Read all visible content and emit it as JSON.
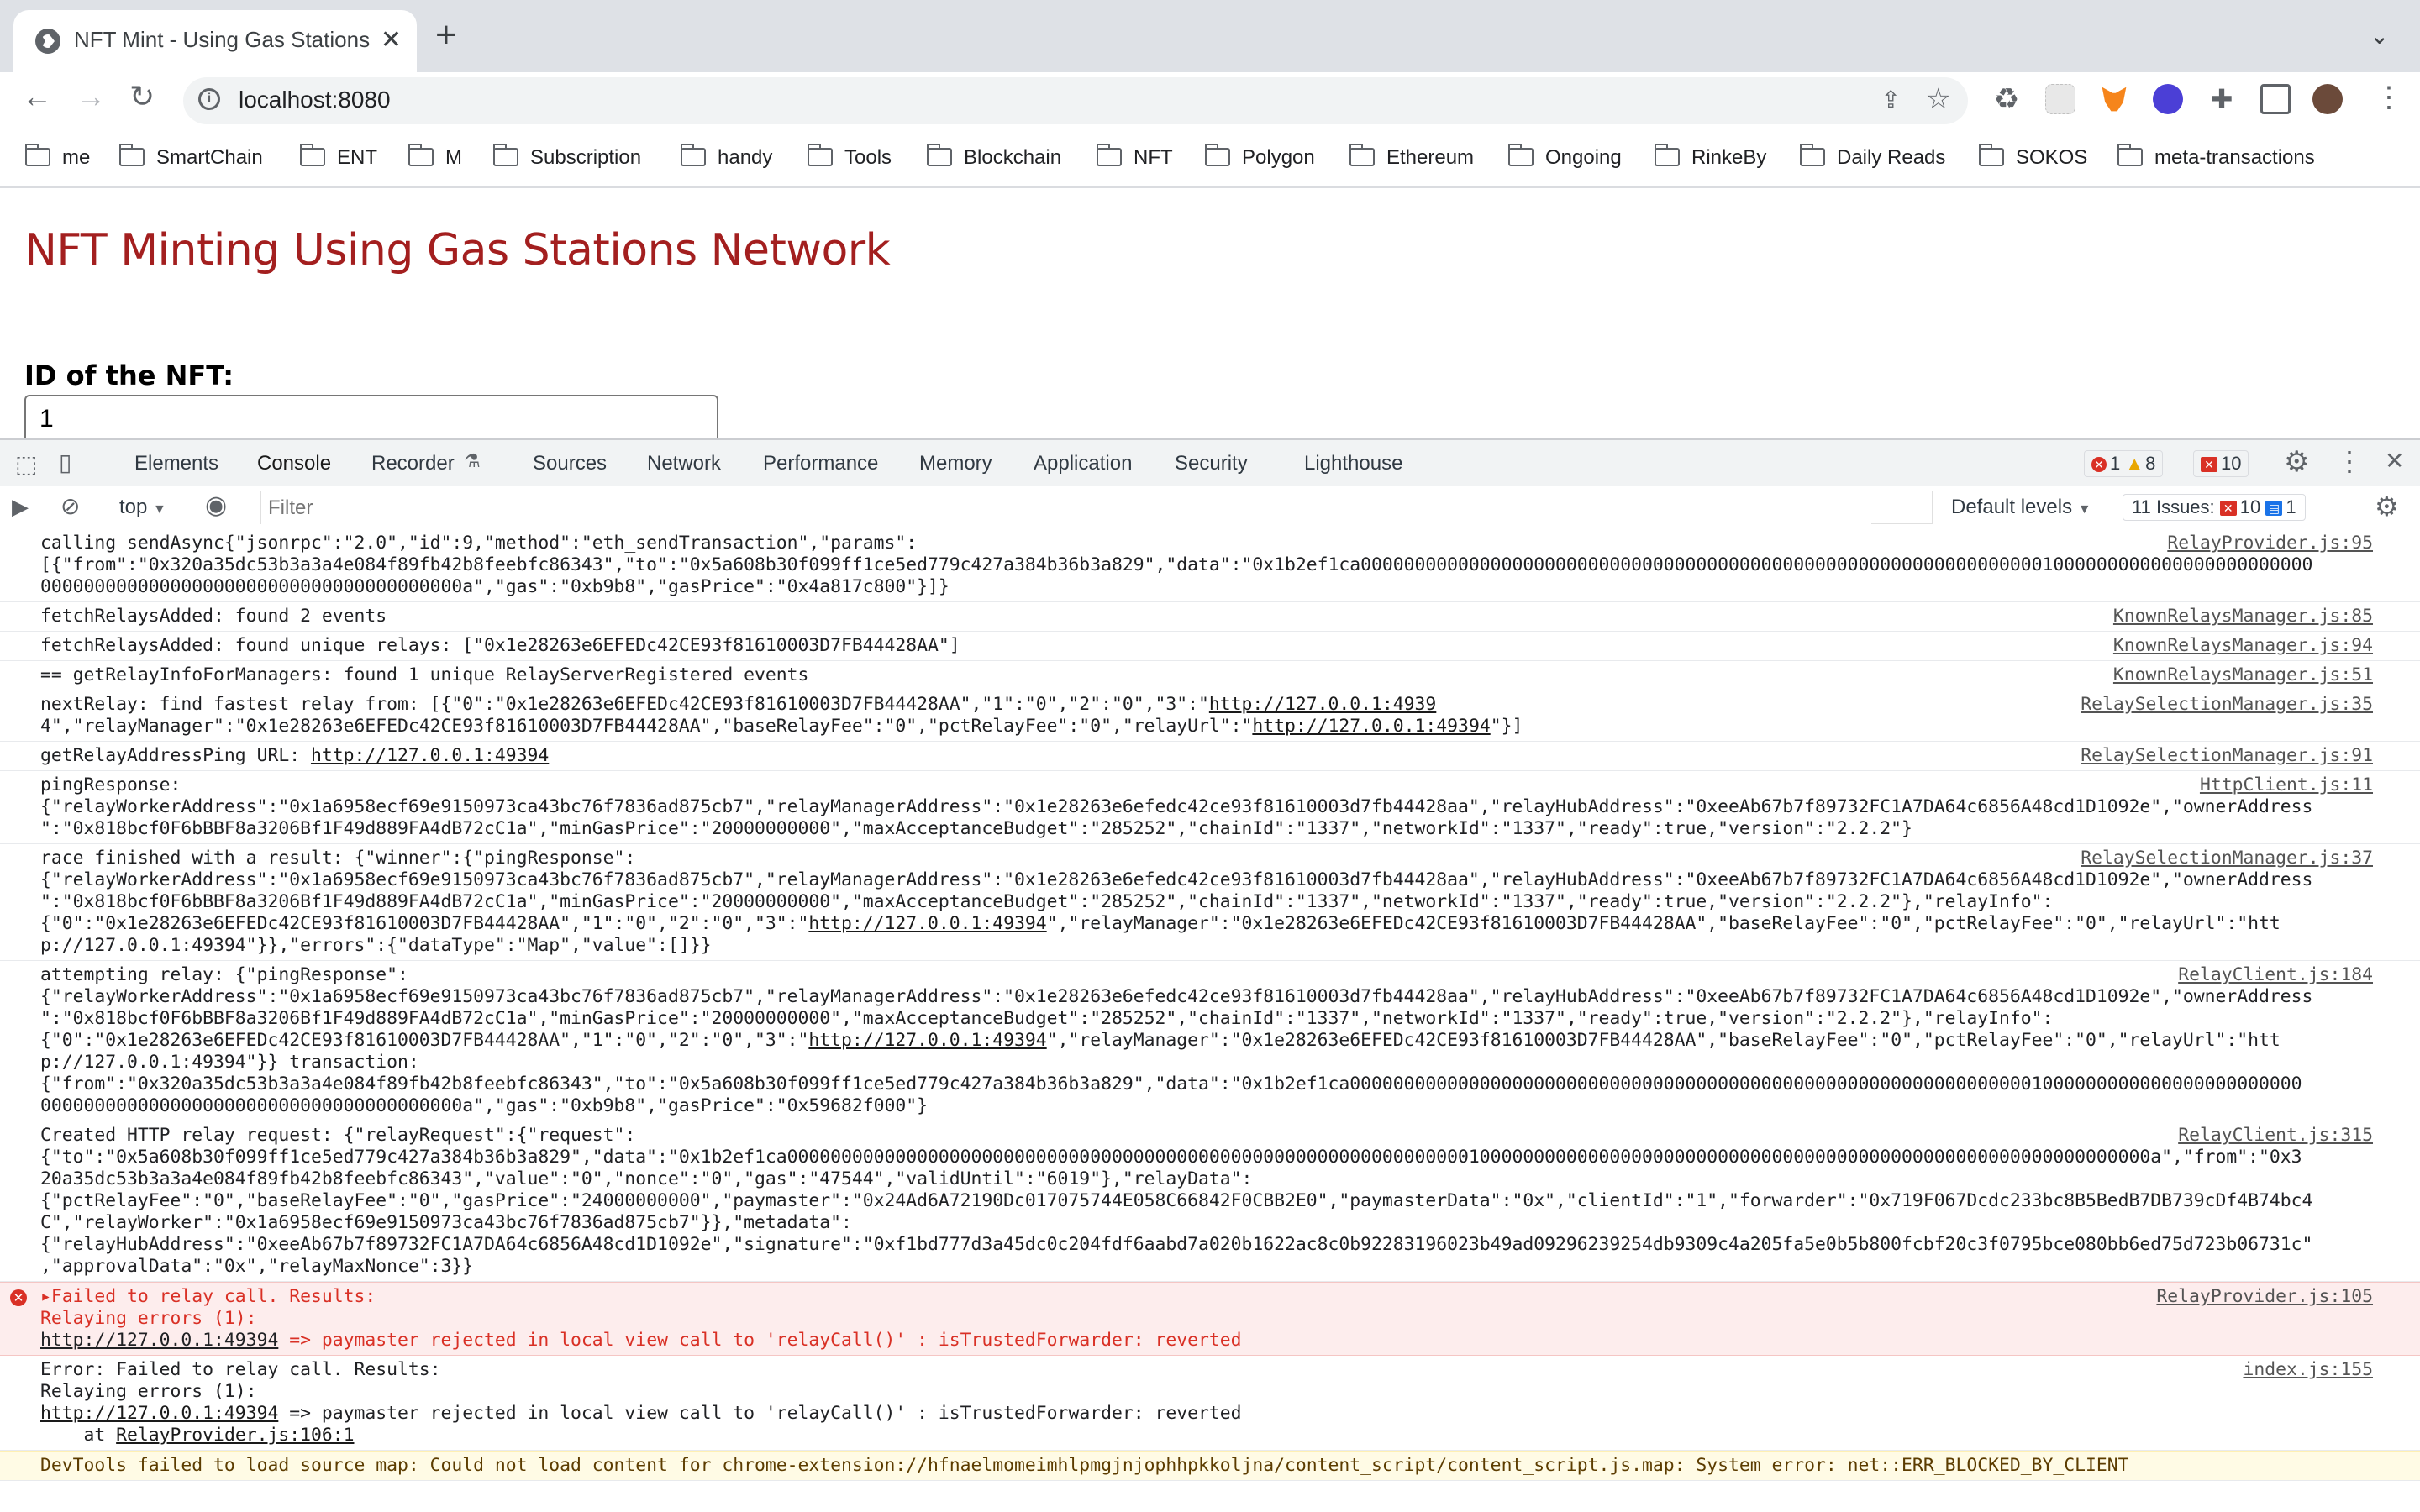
{
  "browser": {
    "tab_title": "NFT Mint - Using Gas Stations",
    "new_tab_label": "+",
    "url": "localhost:8080",
    "bookmarks": [
      "me",
      "SmartChain",
      "ENT",
      "M",
      "Subscription",
      "handy",
      "Tools",
      "Blockchain",
      "NFT",
      "Polygon",
      "Ethereum",
      "Ongoing",
      "RinkeBy",
      "Daily Reads",
      "SOKOS",
      "meta-transactions"
    ]
  },
  "page": {
    "title": "NFT Minting Using Gas Stations Network",
    "id_label": "ID of the NFT:",
    "id_value": "1"
  },
  "devtools": {
    "tabs": [
      "Elements",
      "Console",
      "Recorder",
      "Sources",
      "Network",
      "Performance",
      "Memory",
      "Application",
      "Security",
      "Lighthouse"
    ],
    "active_tab": "Console",
    "counts": {
      "errors": "1",
      "warnings": "8",
      "issues_badge": "10"
    },
    "context": "top",
    "filter_placeholder": "Filter",
    "levels": "Default levels",
    "issues_label": "11 Issues:",
    "issues_errors": "10",
    "issues_info": "1"
  },
  "console": {
    "messages": [
      {
        "text": "calling sendAsync{\"jsonrpc\":\"2.0\",\"id\":9,\"method\":\"eth_sendTransaction\",\"params\":\n[{\"from\":\"0x320a35dc53b3a3a4e084f89fb42b8feebfc86343\",\"to\":\"0x5a608b30f099ff1ce5ed779c427a384b36b3a829\",\"data\":\"0x1b2ef1ca0000000000000000000000000000000000000000000000000000000000000001000000000000000000000000\n000000000000000000000000000000000000000a\",\"gas\":\"0xb9b8\",\"gasPrice\":\"0x4a817c800\"}]}",
        "source": "RelayProvider.js:95"
      },
      {
        "text": "fetchRelaysAdded: found 2 events",
        "source": "KnownRelaysManager.js:85"
      },
      {
        "text": "fetchRelaysAdded: found unique relays: [\"0x1e28263e6EFEDc42CE93f81610003D7FB44428AA\"]",
        "source": "KnownRelaysManager.js:94"
      },
      {
        "text": "== getRelayInfoForManagers: found 1 unique RelayServerRegistered events",
        "source": "KnownRelaysManager.js:51"
      },
      {
        "text": "nextRelay: find fastest relay from: [{\"0\":\"0x1e28263e6EFEDc42CE93f81610003D7FB44428AA\",\"1\":\"0\",\"2\":\"0\",\"3\":\"http://127.0.0.1:4939\n4\",\"relayManager\":\"0x1e28263e6EFEDc42CE93f81610003D7FB44428AA\",\"baseRelayFee\":\"0\",\"pctRelayFee\":\"0\",\"relayUrl\":\"http://127.0.0.1:49394\"}]",
        "source": "RelaySelectionManager.js:35"
      },
      {
        "text": "getRelayAddressPing URL: http://127.0.0.1:49394",
        "source": "RelaySelectionManager.js:91"
      },
      {
        "text": "pingResponse:\n{\"relayWorkerAddress\":\"0x1a6958ecf69e9150973ca43bc76f7836ad875cb7\",\"relayManagerAddress\":\"0x1e28263e6efedc42ce93f81610003d7fb44428aa\",\"relayHubAddress\":\"0xeeAb67b7f89732FC1A7DA64c6856A48cd1D1092e\",\"ownerAddress\n\":\"0x818bcf0F6bBBF8a3206Bf1F49d889FA4dB72cC1a\",\"minGasPrice\":\"20000000000\",\"maxAcceptanceBudget\":\"285252\",\"chainId\":\"1337\",\"networkId\":\"1337\",\"ready\":true,\"version\":\"2.2.2\"}",
        "source": "HttpClient.js:11"
      },
      {
        "text": "race finished with a result: {\"winner\":{\"pingResponse\":\n{\"relayWorkerAddress\":\"0x1a6958ecf69e9150973ca43bc76f7836ad875cb7\",\"relayManagerAddress\":\"0x1e28263e6efedc42ce93f81610003d7fb44428aa\",\"relayHubAddress\":\"0xeeAb67b7f89732FC1A7DA64c6856A48cd1D1092e\",\"ownerAddress\n\":\"0x818bcf0F6bBBF8a3206Bf1F49d889FA4dB72cC1a\",\"minGasPrice\":\"20000000000\",\"maxAcceptanceBudget\":\"285252\",\"chainId\":\"1337\",\"networkId\":\"1337\",\"ready\":true,\"version\":\"2.2.2\"},\"relayInfo\":\n{\"0\":\"0x1e28263e6EFEDc42CE93f81610003D7FB44428AA\",\"1\":\"0\",\"2\":\"0\",\"3\":\"http://127.0.0.1:49394\",\"relayManager\":\"0x1e28263e6EFEDc42CE93f81610003D7FB44428AA\",\"baseRelayFee\":\"0\",\"pctRelayFee\":\"0\",\"relayUrl\":\"htt\np://127.0.0.1:49394\"}},\"errors\":{\"dataType\":\"Map\",\"value\":[]}}",
        "source": "RelaySelectionManager.js:37"
      },
      {
        "text": "attempting relay: {\"pingResponse\":\n{\"relayWorkerAddress\":\"0x1a6958ecf69e9150973ca43bc76f7836ad875cb7\",\"relayManagerAddress\":\"0x1e28263e6efedc42ce93f81610003d7fb44428aa\",\"relayHubAddress\":\"0xeeAb67b7f89732FC1A7DA64c6856A48cd1D1092e\",\"ownerAddress\n\":\"0x818bcf0F6bBBF8a3206Bf1F49d889FA4dB72cC1a\",\"minGasPrice\":\"20000000000\",\"maxAcceptanceBudget\":\"285252\",\"chainId\":\"1337\",\"networkId\":\"1337\",\"ready\":true,\"version\":\"2.2.2\"},\"relayInfo\":\n{\"0\":\"0x1e28263e6EFEDc42CE93f81610003D7FB44428AA\",\"1\":\"0\",\"2\":\"0\",\"3\":\"http://127.0.0.1:49394\",\"relayManager\":\"0x1e28263e6EFEDc42CE93f81610003D7FB44428AA\",\"baseRelayFee\":\"0\",\"pctRelayFee\":\"0\",\"relayUrl\":\"htt\np://127.0.0.1:49394\"}} transaction:\n{\"from\":\"0x320a35dc53b3a3a4e084f89fb42b8feebfc86343\",\"to\":\"0x5a608b30f099ff1ce5ed779c427a384b36b3a829\",\"data\":\"0x1b2ef1ca0000000000000000000000000000000000000000000000000000000000000001000000000000000000000000\n000000000000000000000000000000000000000a\",\"gas\":\"0xb9b8\",\"gasPrice\":\"0x59682f000\"}",
        "source": "RelayClient.js:184"
      },
      {
        "text": "Created HTTP relay request: {\"relayRequest\":{\"request\":\n{\"to\":\"0x5a608b30f099ff1ce5ed779c427a384b36b3a829\",\"data\":\"0x1b2ef1ca000000000000000000000000000000000000000000000000000000000000000100000000000000000000000000000000000000000000000000000000000000a\",\"from\":\"0x3\n20a35dc53b3a3a4e084f89fb42b8feebfc86343\",\"value\":\"0\",\"nonce\":\"0\",\"gas\":\"47544\",\"validUntil\":\"6019\"},\"relayData\":\n{\"pctRelayFee\":\"0\",\"baseRelayFee\":\"0\",\"gasPrice\":\"24000000000\",\"paymaster\":\"0x24Ad6A72190Dc017075744E058C66842F0CBB2E0\",\"paymasterData\":\"0x\",\"clientId\":\"1\",\"forwarder\":\"0x719F067Dcdc233bc8B5BedB7DB739cDf4B74bc4\nC\",\"relayWorker\":\"0x1a6958ecf69e9150973ca43bc76f7836ad875cb7\"}},\"metadata\":\n{\"relayHubAddress\":\"0xeeAb67b7f89732FC1A7DA64c6856A48cd1D1092e\",\"signature\":\"0xf1bd777d3a45dc0c204fdf6aabd7a020b1622ac8c0b92283196023b49ad09296239254db9309c4a205fa5e0b5b800fcbf20c3f0795bce080bb6ed75d723b06731c\"\n,\"approvalData\":\"0x\",\"relayMaxNonce\":3}}",
        "source": "RelayClient.js:315"
      },
      {
        "type": "error",
        "text": "▸Failed to relay call. Results:\nRelaying errors (1):\nhttp://127.0.0.1:49394 => paymaster rejected in local view call to 'relayCall()' : isTrustedForwarder: reverted",
        "source": "RelayProvider.js:105"
      },
      {
        "text": "Error: Failed to relay call. Results:\nRelaying errors (1):\nhttp://127.0.0.1:49394 => paymaster rejected in local view call to 'relayCall()' : isTrustedForwarder: reverted\n    at RelayProvider.js:106:1",
        "source": "index.js:155"
      },
      {
        "type": "warn",
        "text": "DevTools failed to load source map: Could not load content for chrome-extension://hfnaelmomeimhlpmgjnjophhpkkoljna/content_script/content_script.js.map: System error: net::ERR_BLOCKED_BY_CLIENT",
        "source": ""
      }
    ]
  },
  "colors": {
    "page_title": "#a31f1f",
    "error_bg": "#fdeded",
    "accent": "#1a73e8"
  }
}
